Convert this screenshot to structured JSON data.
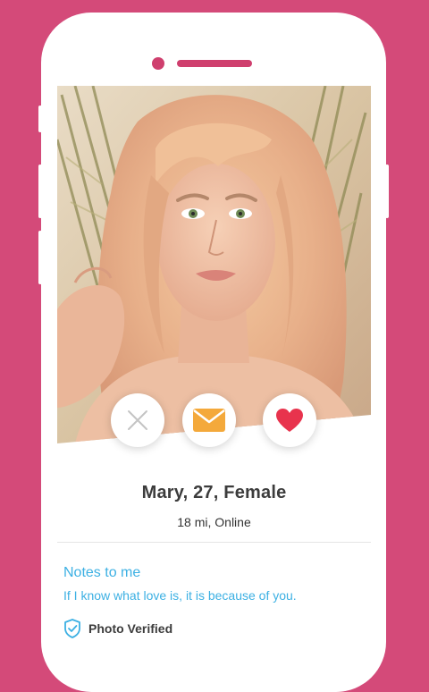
{
  "colors": {
    "background": "#d44a79",
    "accent_pink": "#cf3f6e",
    "link_blue": "#3cb0e3",
    "mail_orange": "#f4a93b",
    "heart_red": "#e8334d"
  },
  "profile": {
    "photo_alt": "Profile photo",
    "name_line": "Mary, 27, Female",
    "meta_line": "18 mi, Online"
  },
  "actions": {
    "pass_icon": "close-icon",
    "message_icon": "envelope-icon",
    "like_icon": "heart-icon"
  },
  "notes": {
    "title": "Notes to me",
    "text": "If I know what love is, it is because of you."
  },
  "verification": {
    "icon": "shield-check-icon",
    "label": "Photo Verified"
  }
}
